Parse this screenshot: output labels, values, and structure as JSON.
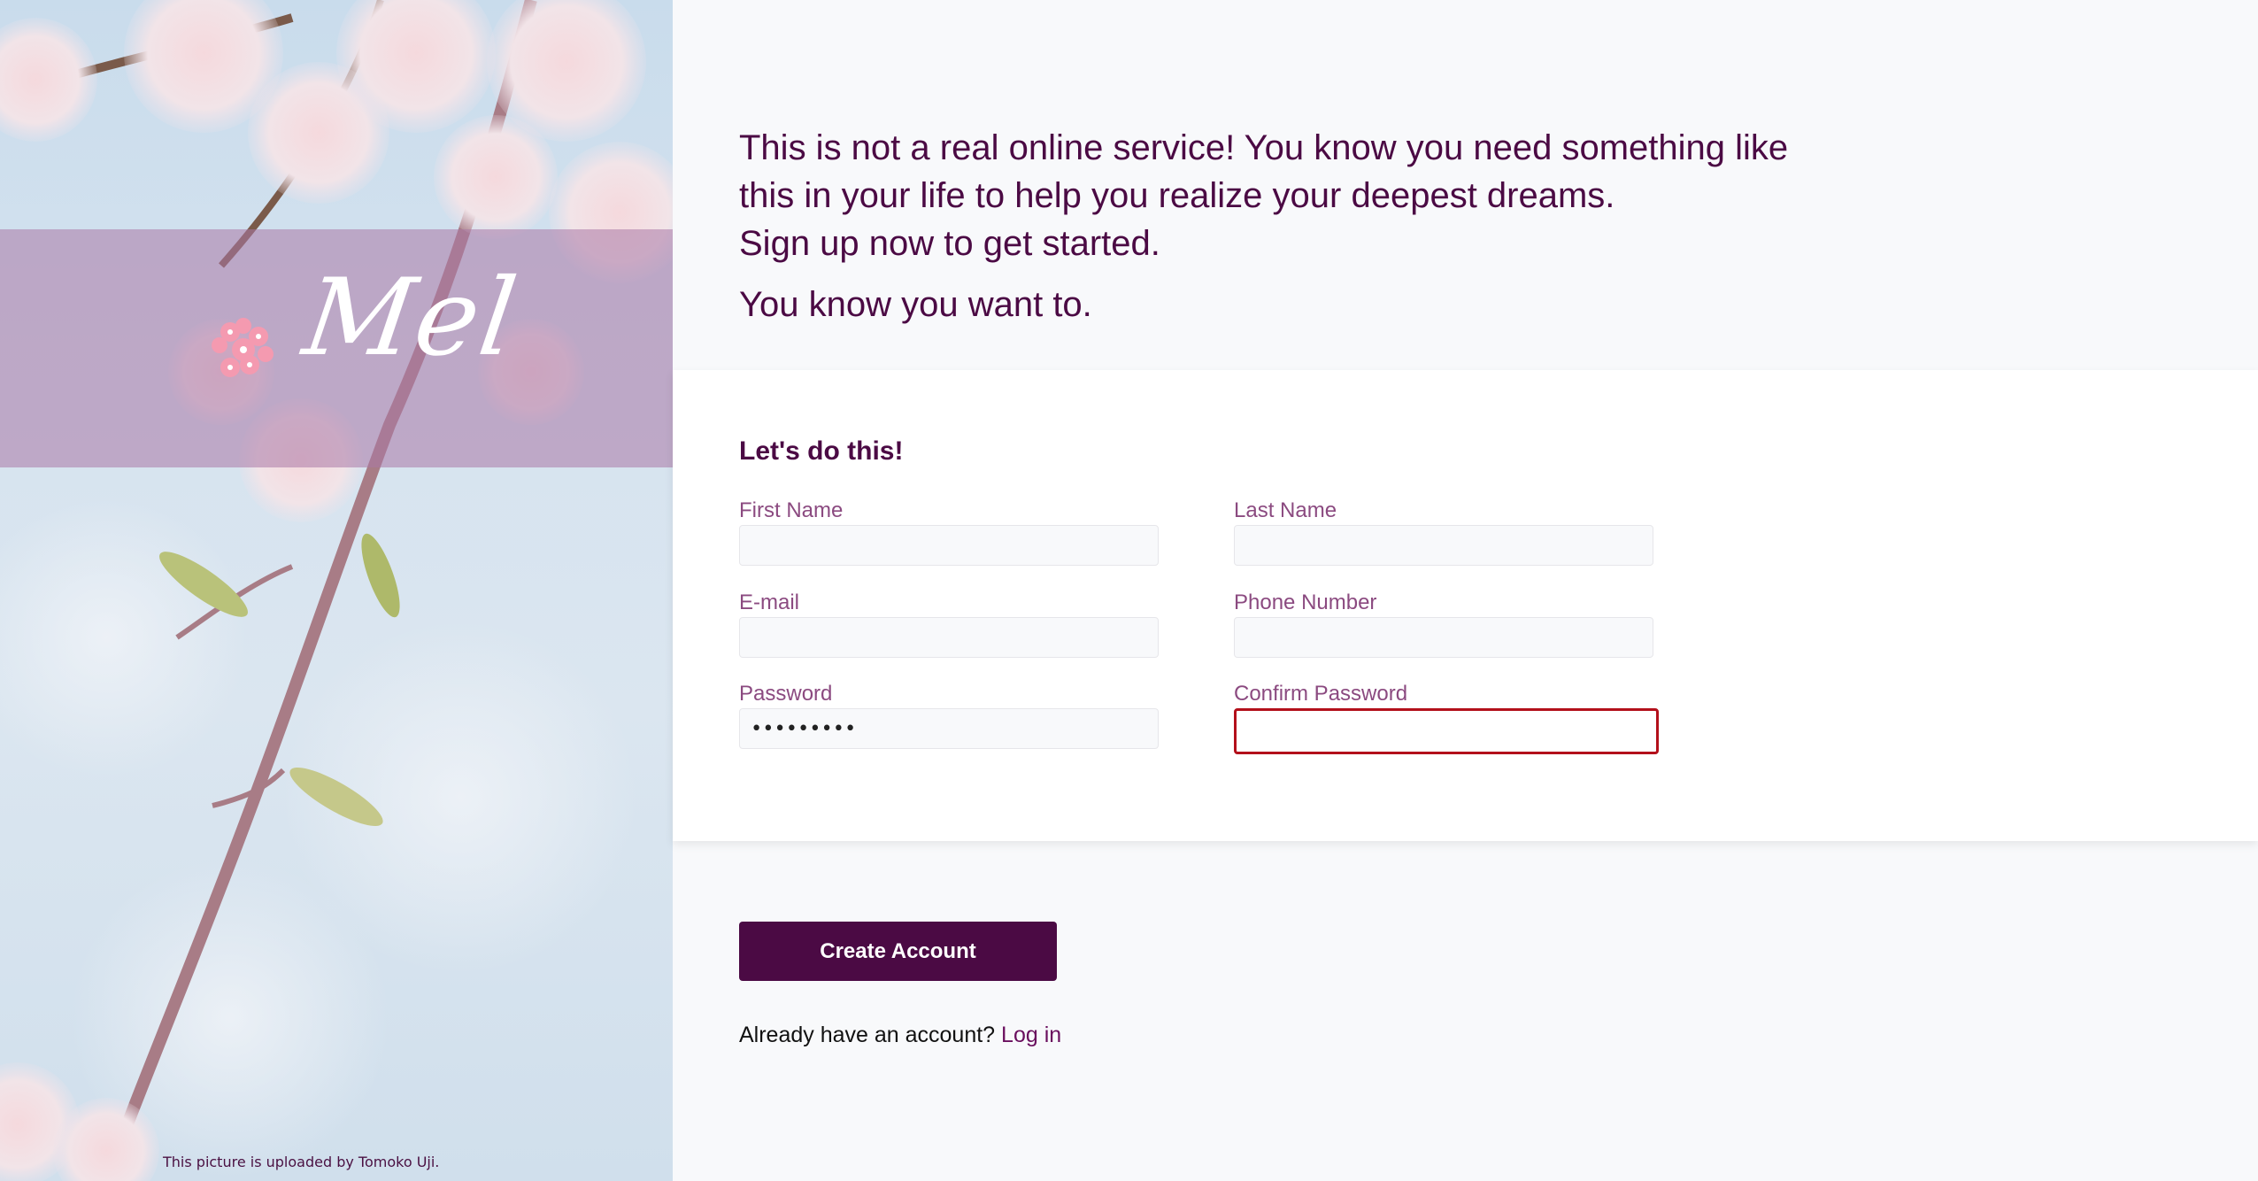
{
  "brand": {
    "logo_text": "Mel",
    "accent_color": "#4b0a44",
    "label_color": "#8b4a80",
    "error_color": "#b3101b"
  },
  "photo": {
    "credit": "This picture is uploaded by Tomoko Uji."
  },
  "hero": {
    "line1": "This is not a real online service! You know you need something like",
    "line2": "this in your life to help you realize your deepest dreams.",
    "line3": "Sign up now to get started.",
    "line4": "You know you want to."
  },
  "form": {
    "heading": "Let's do this!",
    "fields": {
      "first_name": {
        "label": "First Name",
        "value": ""
      },
      "last_name": {
        "label": "Last Name",
        "value": ""
      },
      "email": {
        "label": "E-mail",
        "value": ""
      },
      "phone": {
        "label": "Phone Number",
        "value": ""
      },
      "password": {
        "label": "Password",
        "value": "•••••••••"
      },
      "confirm_password": {
        "label": "Confirm Password",
        "value": "",
        "state": "invalid"
      }
    }
  },
  "actions": {
    "create_account": "Create Account",
    "login_prompt": "Already have an account?",
    "login_link": "Log in"
  },
  "icons": {
    "logo": "cherry-blossom-icon"
  }
}
